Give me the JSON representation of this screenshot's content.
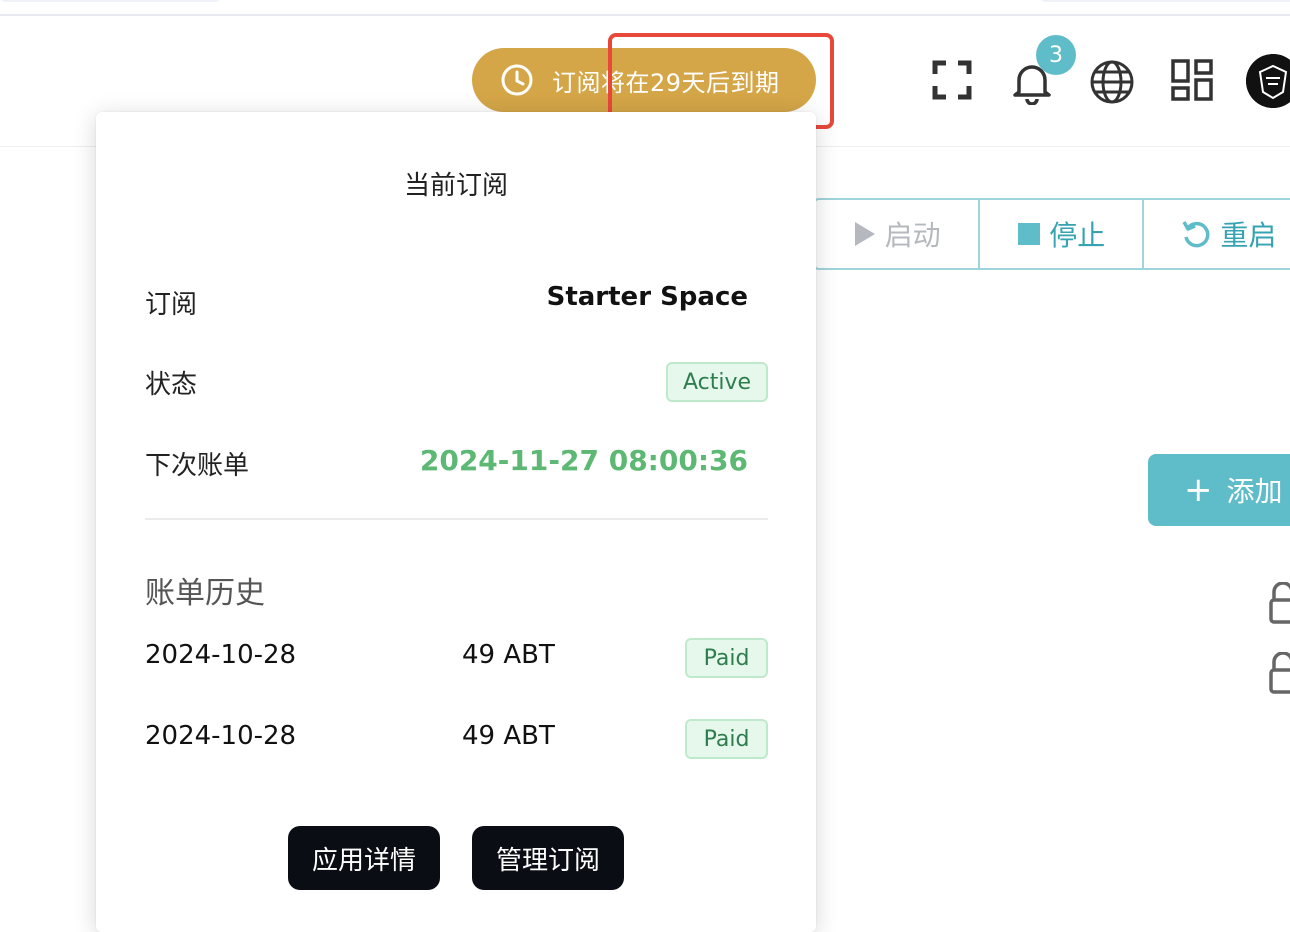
{
  "header": {
    "expiry_text": "订阅将在29天后到期",
    "notification_count": "3",
    "icons": [
      "clock-icon",
      "fullscreen-icon",
      "bell-icon",
      "globe-icon",
      "apps-grid-icon",
      "avatar"
    ]
  },
  "actions": {
    "start_label": "启动",
    "stop_label": "停止",
    "restart_label": "重启",
    "add_label": "添加"
  },
  "subscription_popover": {
    "title": "当前订阅",
    "plan_label": "订阅",
    "plan_value": "Starter Space",
    "status_label": "状态",
    "status_value": "Active",
    "next_bill_label": "下次账单",
    "next_bill_value": "2024-11-27 08:00:36",
    "history_title": "账单历史",
    "history": [
      {
        "date": "2024-10-28",
        "amount": "49 ABT",
        "status": "Paid"
      },
      {
        "date": "2024-10-28",
        "amount": "49 ABT",
        "status": "Paid"
      }
    ],
    "app_details_label": "应用详情",
    "manage_label": "管理订阅"
  },
  "colors": {
    "expiry_pill": "#d4a648",
    "highlight_border": "#e8483a",
    "accent_teal": "#5fbcc9",
    "next_bill_green": "#5cb872",
    "dark_button": "#0b0d14"
  }
}
